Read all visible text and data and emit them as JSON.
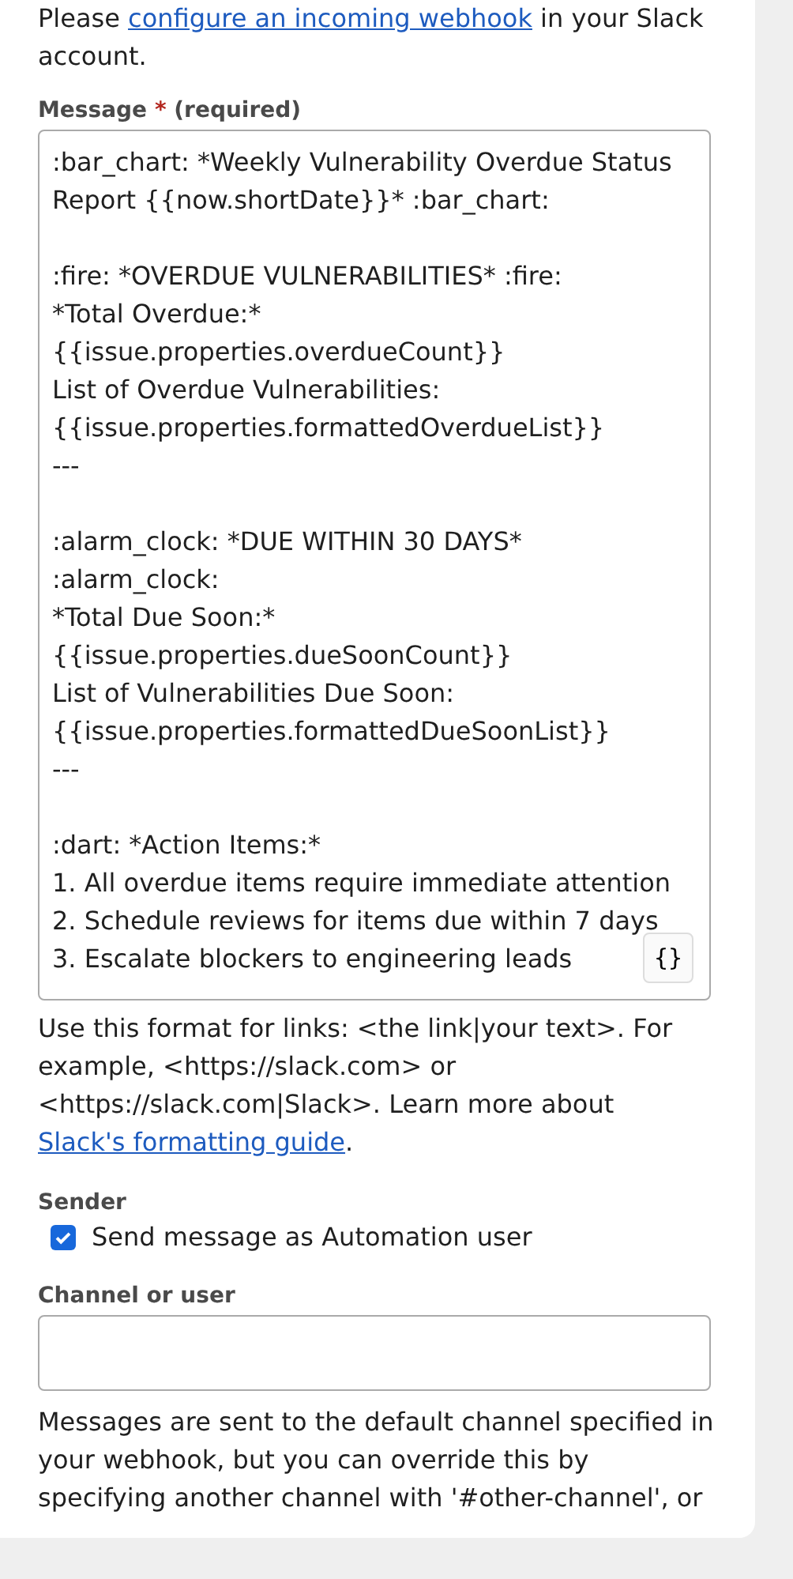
{
  "intro": {
    "before": "Please ",
    "link": "configure an incoming webhook",
    "after": " in your Slack account."
  },
  "message": {
    "label": "Message",
    "required_mark": "*",
    "required_note": "(required)",
    "value": ":bar_chart: *Weekly Vulnerability Overdue Status Report {{now.shortDate}}* :bar_chart:\n\n:fire: *OVERDUE VULNERABILITIES* :fire:\n*Total Overdue:*\n{{issue.properties.overdueCount}}\nList of Overdue Vulnerabilities:\n{{issue.properties.formattedOverdueList}}\n---\n\n:alarm_clock: *DUE WITHIN 30 DAYS* :alarm_clock:\n*Total Due Soon:*\n{{issue.properties.dueSoonCount}}\nList of Vulnerabilities Due Soon:\n{{issue.properties.formattedDueSoonList}}\n---\n\n:dart: *Action Items:*\n1. All overdue items require immediate attention\n2. Schedule reviews for items due within 7 days\n3. Escalate blockers to engineering leads",
    "smart_value_button": "{}"
  },
  "help": {
    "before": "Use this format for links: <the link|your text>. For example, <https://slack.com> or <https://slack.com|Slack>. Learn more about ",
    "link": "Slack's formatting guide",
    "after": "."
  },
  "sender": {
    "label": "Sender",
    "checkbox_label": "Send message as Automation user",
    "checked": true
  },
  "channel": {
    "label": "Channel or user"
  },
  "channel_help": "Messages are sent to the default channel specified in your webhook, but you can override this by specifying another channel with '#other-channel', or"
}
